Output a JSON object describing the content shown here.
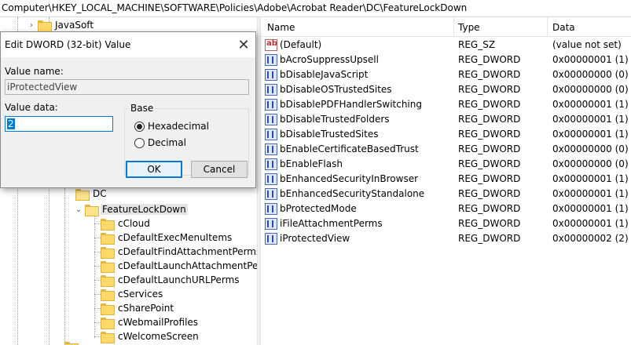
{
  "address_bar": {
    "path": "Computer\\HKEY_LOCAL_MACHINE\\SOFTWARE\\Policies\\Adobe\\Acrobat Reader\\DC\\FeatureLockDown"
  },
  "tree": {
    "items": [
      {
        "label": "JavaSoft",
        "expander": "›",
        "expanded": false
      },
      {
        "label": "DC",
        "expander": "",
        "expanded": true
      },
      {
        "label": "FeatureLockDown",
        "expander": "⌄",
        "expanded": true,
        "selected": true
      },
      {
        "label": "cCloud"
      },
      {
        "label": "cDefaultExecMenuItems"
      },
      {
        "label": "cDefaultFindAttachmentPerms"
      },
      {
        "label": "cDefaultLaunchAttachmentPer"
      },
      {
        "label": "cDefaultLaunchURLPerms"
      },
      {
        "label": "cServices"
      },
      {
        "label": "cSharePoint"
      },
      {
        "label": "cWebmailProfiles"
      },
      {
        "label": "cWelcomeScreen"
      }
    ]
  },
  "values_pane": {
    "columns": {
      "name": "Name",
      "type": "Type",
      "data": "Data"
    },
    "rows": [
      {
        "name": "(Default)",
        "type": "REG_SZ",
        "data": "(value not set)",
        "icon": "string-value-icon"
      },
      {
        "name": "bAcroSuppressUpsell",
        "type": "REG_DWORD",
        "data": "0x00000001 (1)",
        "icon": "dword-value-icon"
      },
      {
        "name": "bDisableJavaScript",
        "type": "REG_DWORD",
        "data": "0x00000000 (0)",
        "icon": "dword-value-icon"
      },
      {
        "name": "bDisableOSTrustedSites",
        "type": "REG_DWORD",
        "data": "0x00000000 (0)",
        "icon": "dword-value-icon"
      },
      {
        "name": "bDisablePDFHandlerSwitching",
        "type": "REG_DWORD",
        "data": "0x00000001 (1)",
        "icon": "dword-value-icon"
      },
      {
        "name": "bDisableTrustedFolders",
        "type": "REG_DWORD",
        "data": "0x00000001 (1)",
        "icon": "dword-value-icon"
      },
      {
        "name": "bDisableTrustedSites",
        "type": "REG_DWORD",
        "data": "0x00000001 (1)",
        "icon": "dword-value-icon"
      },
      {
        "name": "bEnableCertificateBasedTrust",
        "type": "REG_DWORD",
        "data": "0x00000000 (0)",
        "icon": "dword-value-icon"
      },
      {
        "name": "bEnableFlash",
        "type": "REG_DWORD",
        "data": "0x00000000 (0)",
        "icon": "dword-value-icon"
      },
      {
        "name": "bEnhancedSecurityInBrowser",
        "type": "REG_DWORD",
        "data": "0x00000001 (1)",
        "icon": "dword-value-icon"
      },
      {
        "name": "bEnhancedSecurityStandalone",
        "type": "REG_DWORD",
        "data": "0x00000001 (1)",
        "icon": "dword-value-icon"
      },
      {
        "name": "bProtectedMode",
        "type": "REG_DWORD",
        "data": "0x00000001 (1)",
        "icon": "dword-value-icon"
      },
      {
        "name": "iFileAttachmentPerms",
        "type": "REG_DWORD",
        "data": "0x00000001 (1)",
        "icon": "dword-value-icon"
      },
      {
        "name": "iProtectedView",
        "type": "REG_DWORD",
        "data": "0x00000002 (2)",
        "icon": "dword-value-icon"
      }
    ]
  },
  "dialog": {
    "title": "Edit DWORD (32-bit) Value",
    "close_glyph": "✕",
    "value_name_label": "Value name:",
    "value_name": "iProtectedView",
    "value_data_label": "Value data:",
    "value_data": "2",
    "base_label": "Base",
    "base_options": [
      {
        "label": "Hexadecimal",
        "selected": true
      },
      {
        "label": "Decimal",
        "selected": false
      }
    ],
    "ok_label": "OK",
    "cancel_label": "Cancel"
  },
  "colors": {
    "accent": "#0078d7",
    "folder": "#fcd968",
    "selection": "#e5e5e5"
  }
}
